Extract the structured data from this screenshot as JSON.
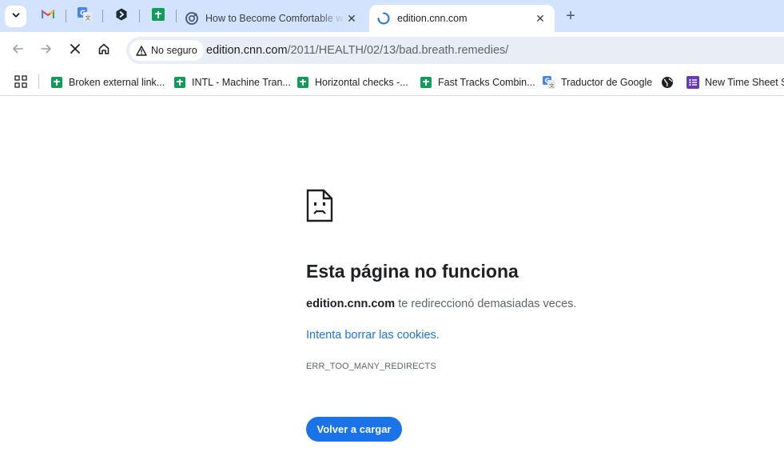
{
  "tabs": {
    "inactive_title": "How to Become Comfortable w",
    "active_title": "edition.cnn.com",
    "new_tab_symbol": "+"
  },
  "pinned_icons": [
    "gmail-icon",
    "google-translate-icon",
    "dark-hex-app-icon",
    "google-sheets-icon"
  ],
  "toolbar": {
    "security_label": "No seguro",
    "url_host": "edition.cnn.com",
    "url_path": "/2011/HEALTH/02/13/bad.breath.remedies/"
  },
  "bookmarks": [
    {
      "label": "Broken external link...",
      "icon": "google-sheets-icon"
    },
    {
      "label": "INTL - Machine Tran...",
      "icon": "google-sheets-icon"
    },
    {
      "label": "Horizontal checks -...",
      "icon": "google-sheets-icon"
    },
    {
      "label": "Fast Tracks Combin...",
      "icon": "google-sheets-icon"
    },
    {
      "label": "Traductor de Google",
      "icon": "google-translate-icon"
    },
    {
      "label": "",
      "icon": "globe-icon"
    },
    {
      "label": "New Time Sheet Su",
      "icon": "google-forms-icon"
    }
  ],
  "error": {
    "title": "Esta página no funciona",
    "host": "edition.cnn.com",
    "description": " te redireccionó demasiadas veces.",
    "link": "Intenta borrar las cookies.",
    "code": "ERR_TOO_MANY_REDIRECTS",
    "reload_label": "Volver a cargar"
  },
  "colors": {
    "tabstrip": "#d3e3fd",
    "accent": "#1a73e8",
    "sheets_green": "#0f9d58"
  }
}
